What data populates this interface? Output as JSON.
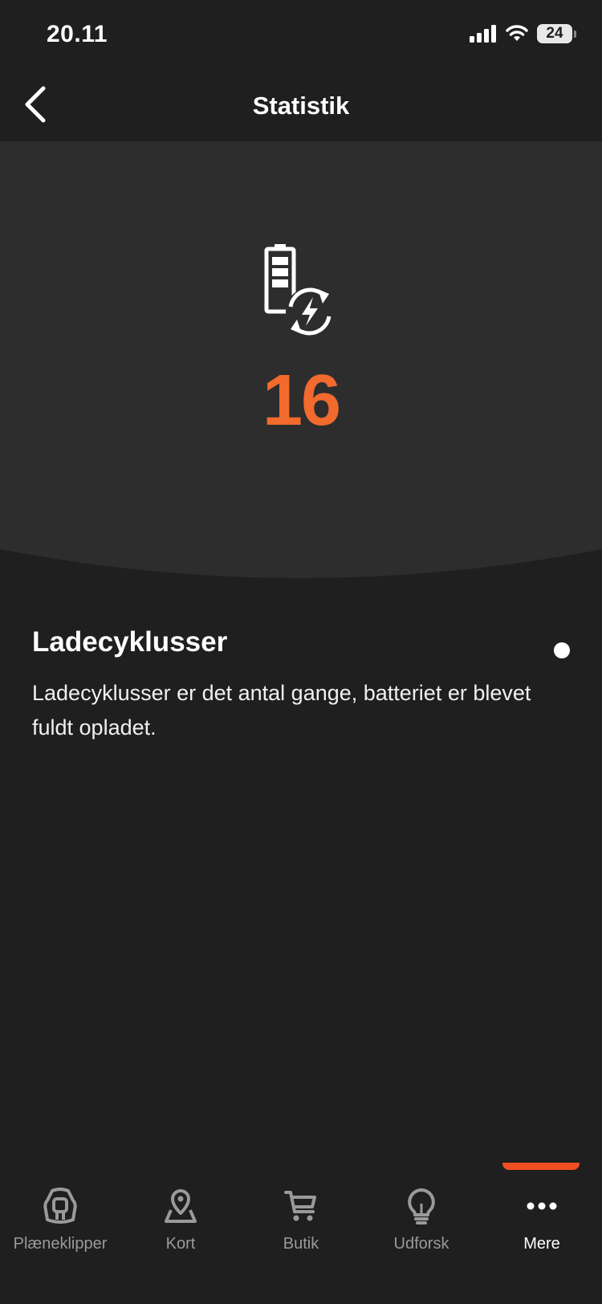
{
  "status_bar": {
    "time": "20.11",
    "battery": "24"
  },
  "nav": {
    "title": "Statistik"
  },
  "hero": {
    "value": "16"
  },
  "info": {
    "title": "Ladecyklusser",
    "description": "Ladecyklusser er det antal gange, batteriet er blevet fuldt opladet."
  },
  "tabs": [
    {
      "label": "Plæneklipper",
      "icon": "mower-icon",
      "active": false
    },
    {
      "label": "Kort",
      "icon": "map-pin-icon",
      "active": false
    },
    {
      "label": "Butik",
      "icon": "cart-icon",
      "active": false
    },
    {
      "label": "Udforsk",
      "icon": "lightbulb-icon",
      "active": false
    },
    {
      "label": "Mere",
      "icon": "more-dots-icon",
      "active": true
    }
  ],
  "colors": {
    "background": "#1f1f1f",
    "hero_background": "#2d2d2d",
    "accent": "#f26a2e",
    "tab_indicator": "#f04e23",
    "inactive_tab": "#9a9a9a"
  }
}
